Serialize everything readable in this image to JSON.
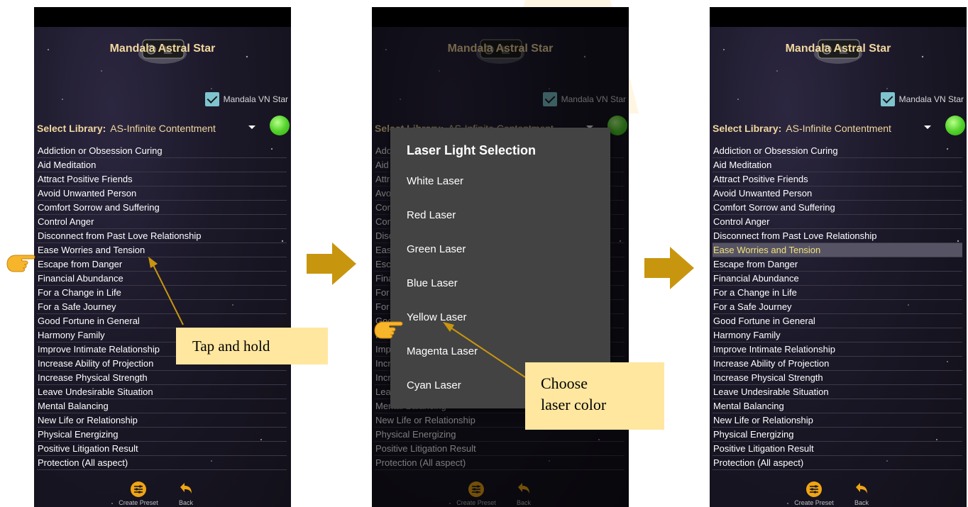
{
  "accent": {
    "title_gold": "#f2d79f",
    "selected_text": "#f2e07a",
    "callout_bg": "#ffe7a0",
    "arrow": "#c8960e"
  },
  "app": {
    "title": "Mandala Astral Star",
    "vn_star_label": "Mandala VN Star",
    "vn_star_checked": true,
    "library_label": "Select Library:",
    "library_value": "AS-Infinite Contentment",
    "status_led": "green"
  },
  "list_items": [
    "Addiction or Obsession Curing",
    "Aid Meditation",
    "Attract Positive Friends",
    "Avoid Unwanted Person",
    "Comfort Sorrow and Suffering",
    "Control Anger",
    "Disconnect from Past Love Relationship",
    "Ease Worries and Tension",
    "Escape from Danger",
    "Financial Abundance",
    "For a Change in Life",
    "For a Safe Journey",
    "Good Fortune in General",
    "Harmony Family",
    "Improve Intimate Relationship",
    "Increase Ability of Projection",
    "Increase Physical Strength",
    "Leave Undesirable Situation",
    "Mental Balancing",
    "New Life or Relationship",
    "Physical Energizing",
    "Positive Litigation Result",
    "Protection (All aspect)"
  ],
  "selected_item": "Ease Worries and Tension",
  "bottom_bar": {
    "preset_label": "Create Preset",
    "back_label": "Back"
  },
  "dialog": {
    "title": "Laser Light Selection",
    "options": [
      "White Laser",
      "Red Laser",
      "Green Laser",
      "Blue Laser",
      "Yellow Laser",
      "Magenta Laser",
      "Cyan Laser"
    ]
  },
  "callouts": {
    "tap_hold": "Tap and hold",
    "choose_line1": "Choose",
    "choose_line2": "laser color"
  }
}
